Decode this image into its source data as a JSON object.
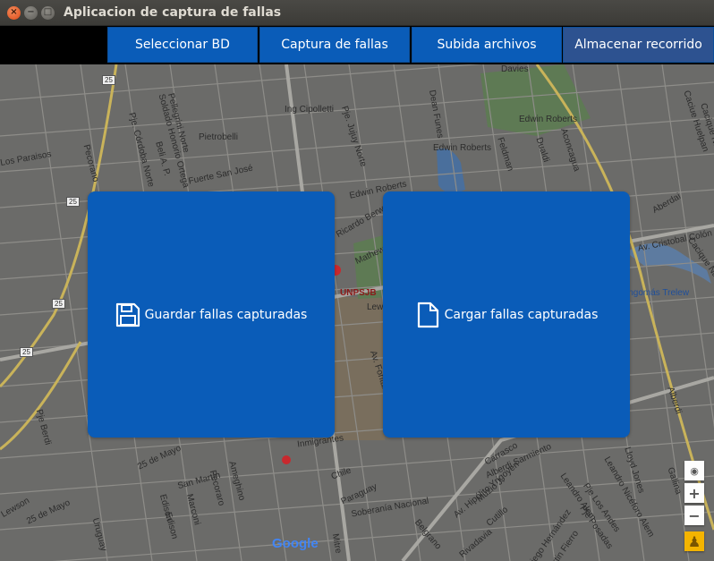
{
  "window": {
    "title": "Aplicacion de captura de fallas",
    "close_glyph": "×",
    "min_glyph": "−",
    "max_glyph": "□"
  },
  "nav": {
    "items": [
      {
        "label": "Seleccionar BD",
        "active": false
      },
      {
        "label": "Captura de fallas",
        "active": false
      },
      {
        "label": "Subida archivos",
        "active": false
      },
      {
        "label": "Almacenar recorrido",
        "active": true
      }
    ]
  },
  "cards": {
    "save": {
      "label": "Guardar fallas capturadas",
      "icon": "floppy-disk-icon"
    },
    "load": {
      "label": "Cargar fallas capturadas",
      "icon": "document-icon"
    }
  },
  "map": {
    "labels": [
      "Ing Cipolletti",
      "Pje. Jujuy Norte",
      "Edwin Roberts",
      "Edwin Roberts",
      "Edwin Roberts",
      "Dean Funes",
      "Pje. Córdoba Norte",
      "Soldado Honorio Ortega",
      "Pellegrini Norte",
      "Pietrobelli",
      "Fuerte San José",
      "Pecorano",
      "Beli A. P.",
      "Ricardo Berwyn",
      "Mathews",
      "UNPSJB",
      "Lewis",
      "Av. Fontana",
      "Av. Cristobal Colón",
      "Pangomás Trelew",
      "Cacique Nahuelpan",
      "Caciue Huelpan",
      "Aconcagua",
      "Dualdi",
      "Feldman",
      "Inmigrantes",
      "Chile",
      "Paraguay",
      "Soberanía Nacional",
      "Av. Hipólito Yrigoyen",
      "Muzio J.",
      "Cutillo",
      "San Martín",
      "Ameghino",
      "Pecoraro",
      "Marconi",
      "Edison",
      "25 de Mayo",
      "25 de Mayo",
      "Pje Berdi",
      "Belgrano",
      "Lloyd Jones",
      "Pje Los Andes",
      "Leandro Alem",
      "Pje Posadas",
      "Uruguay",
      "Mitre",
      "Rivadavia",
      "Alberdi",
      "Los Paraisos",
      "Edison",
      "Lewson",
      "Gallina",
      "Davies",
      "Cacique Nahuelgán",
      "Alberdi Sarmiento",
      "Martin Fierro",
      "Diego Hernández",
      "Leandro Nicéforo Alem",
      "Aberdai",
      "Carrasco"
    ],
    "google": "Google",
    "route_shields": [
      "25",
      "25",
      "25",
      "25"
    ],
    "zoom_in": "+",
    "zoom_out": "−"
  },
  "colors": {
    "nav_blue": "#0a5cb8",
    "nav_active": "#2d5290",
    "card_blue": "#0a5cb8"
  }
}
